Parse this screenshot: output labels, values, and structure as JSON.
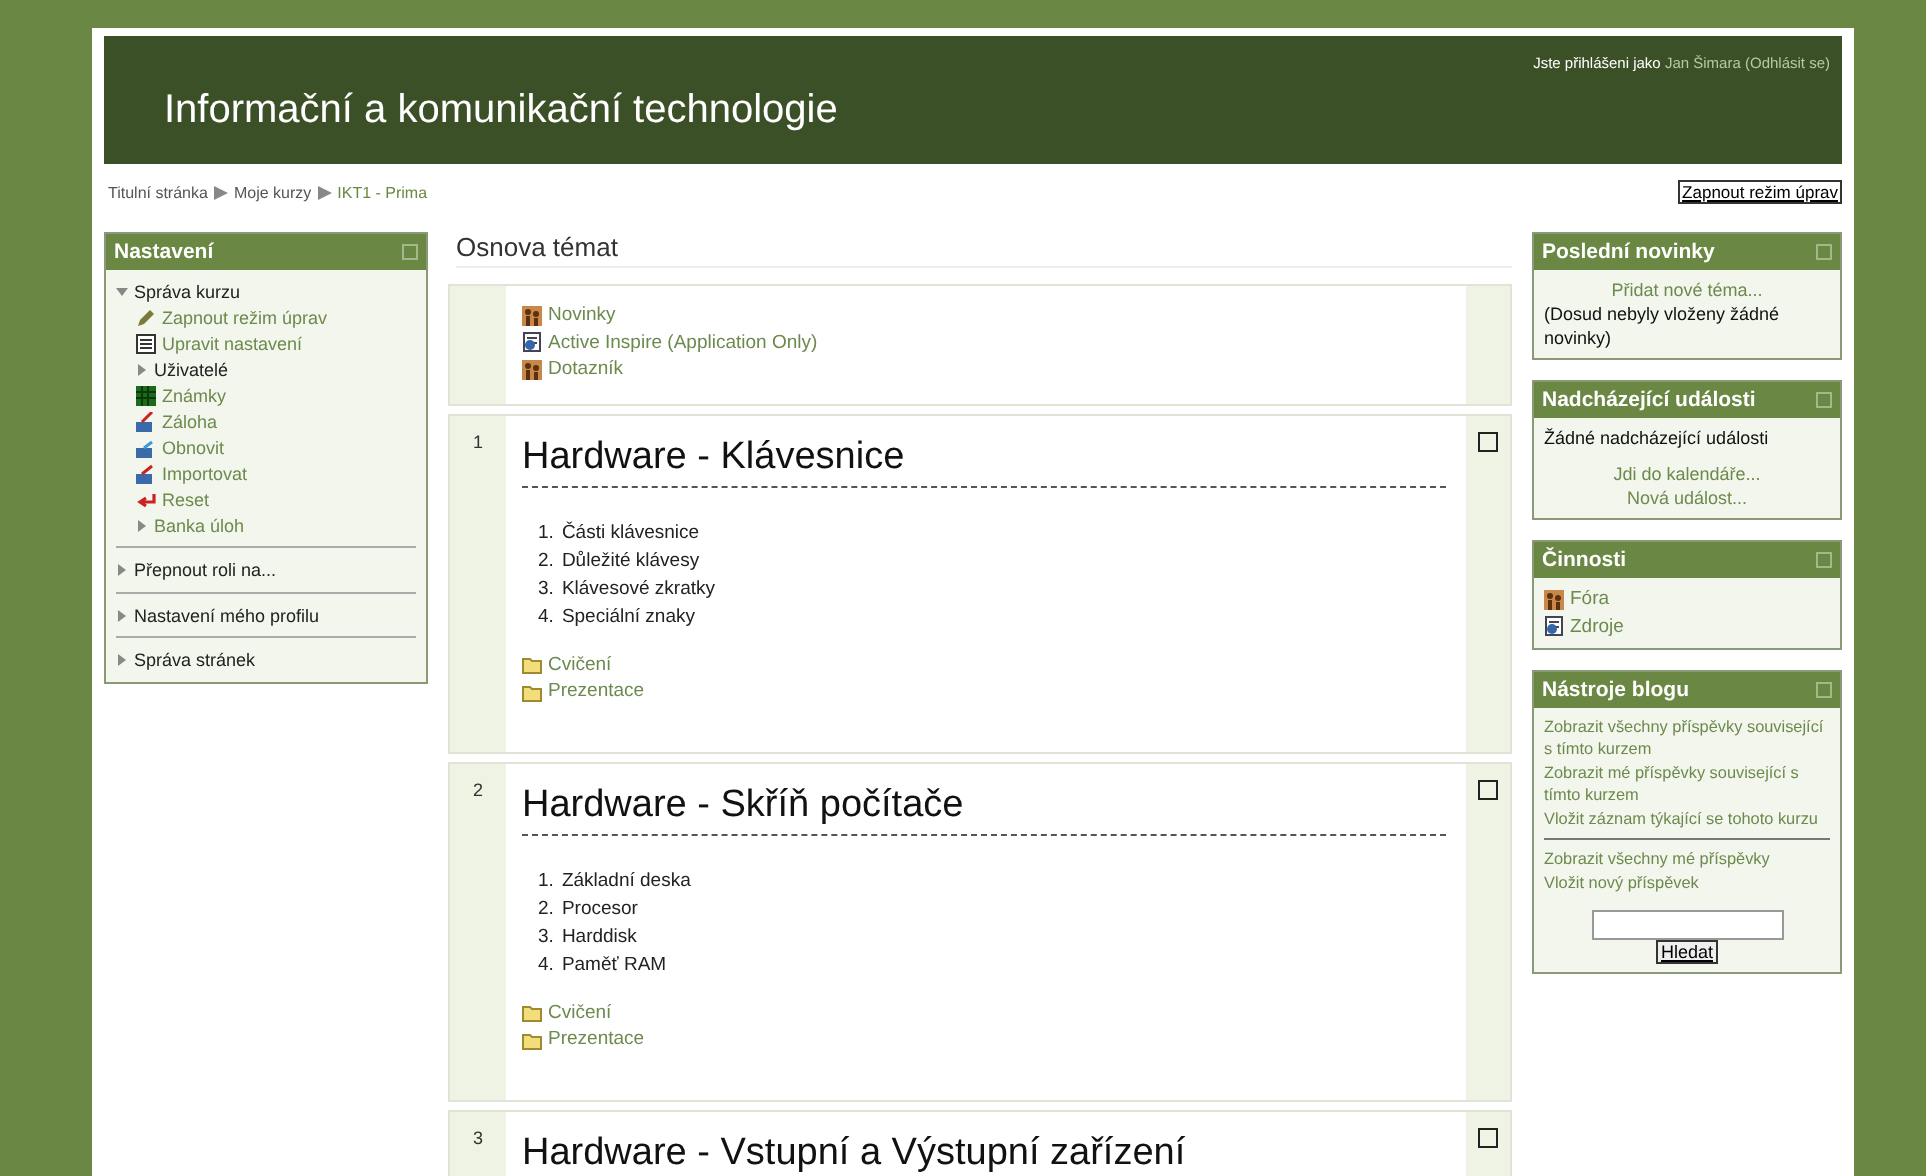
{
  "header": {
    "title": "Informační a komunikační technologie",
    "login_prefix": "Jste přihlášeni jako",
    "user": "Jan Šimara",
    "logout": "(Odhlásit se)"
  },
  "breadcrumb": [
    "Titulní stránka",
    "Moje kurzy",
    "IKT1 - Prima"
  ],
  "edit_button": "Zapnout režim úprav",
  "settings_block": {
    "title": "Nastavení",
    "items": [
      {
        "label": "Správa kurzu",
        "kind": "branch",
        "link": false,
        "expanded": true,
        "children": [
          {
            "label": "Zapnout režim úprav",
            "kind": "edit"
          },
          {
            "label": "Upravit nastavení",
            "kind": "settings"
          },
          {
            "label": "Uživatelé",
            "kind": "branch",
            "link": false,
            "expanded": false
          },
          {
            "label": "Známky",
            "kind": "grades"
          },
          {
            "label": "Záloha",
            "kind": "backup"
          },
          {
            "label": "Obnovit",
            "kind": "restore"
          },
          {
            "label": "Importovat",
            "kind": "import"
          },
          {
            "label": "Reset",
            "kind": "reset"
          },
          {
            "label": "Banka úloh",
            "kind": "branch",
            "link": true,
            "expanded": false
          }
        ]
      },
      {
        "label": "Přepnout roli na...",
        "kind": "branch",
        "link": false,
        "expanded": false
      },
      {
        "label": "Nastavení mého profilu",
        "kind": "branch",
        "link": false,
        "expanded": false
      },
      {
        "label": "Správa stránek",
        "kind": "branch",
        "link": false,
        "expanded": false
      }
    ]
  },
  "main": {
    "heading": "Osnova témat",
    "sections": [
      {
        "resources": [
          {
            "label": "Novinky",
            "kind": "forum"
          },
          {
            "label": "Active Inspire (Application Only)",
            "kind": "file"
          },
          {
            "label": "Dotazník",
            "kind": "forum"
          }
        ]
      },
      {
        "number": "1",
        "title": "Hardware - Klávesnice",
        "items": [
          {
            "marker": "1.",
            "text": "Části klávesnice"
          },
          {
            "marker": "2.",
            "text": "Důležité klávesy"
          },
          {
            "marker": "3.",
            "text": "Klávesové zkratky"
          },
          {
            "marker": "4.",
            "text": "Speciální znaky"
          }
        ],
        "resources": [
          {
            "label": "Cvičení",
            "kind": "folder"
          },
          {
            "label": "Prezentace",
            "kind": "folder"
          }
        ]
      },
      {
        "number": "2",
        "title": "Hardware - Skříň počítače",
        "items": [
          {
            "marker": "1.",
            "text": "Základní deska"
          },
          {
            "marker": "2.",
            "text": "Procesor"
          },
          {
            "marker": "3.",
            "text": "Harddisk"
          },
          {
            "marker": "4.",
            "text": "Paměť RAM"
          }
        ],
        "resources": [
          {
            "label": "Cvičení",
            "kind": "folder"
          },
          {
            "label": "Prezentace",
            "kind": "folder"
          }
        ]
      },
      {
        "number": "3",
        "title": "Hardware - Vstupní a Výstupní zařízení"
      }
    ]
  },
  "news_block": {
    "title": "Poslední novinky",
    "add_link": "Přidat nové téma...",
    "empty": "(Dosud nebyly vloženy žádné novinky)"
  },
  "events_block": {
    "title": "Nadcházející události",
    "empty": "Žádné nadcházející události",
    "links": [
      "Jdi do kalendáře...",
      "Nová událost..."
    ]
  },
  "activities_block": {
    "title": "Činnosti",
    "items": [
      {
        "label": "Fóra",
        "kind": "forum"
      },
      {
        "label": "Zdroje",
        "kind": "file"
      }
    ]
  },
  "blog_block": {
    "title": "Nástroje blogu",
    "links": [
      "Zobrazit všechny příspěvky související s tímto kurzem",
      "Zobrazit mé příspěvky související s tímto kurzem",
      "Vložit záznam týkající se tohoto kurzu"
    ],
    "links2": [
      "Zobrazit všechny mé příspěvky",
      "Vložit nový příspěvek"
    ],
    "search_button": "Hledat"
  }
}
